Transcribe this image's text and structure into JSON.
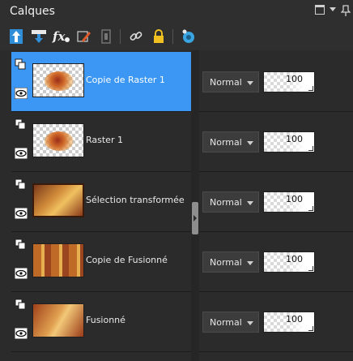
{
  "window": {
    "title": "Calques"
  },
  "toolbar": {
    "icons": [
      "move-layer-up-icon",
      "move-layer-down-icon",
      "fx-effects-icon",
      "edit-layer-icon",
      "mask-icon",
      "link-icon",
      "lock-icon",
      "palette-icon"
    ]
  },
  "layers": [
    {
      "name": "Copie de Raster 1",
      "blend_mode": "Normal",
      "opacity": "100",
      "selected": true,
      "thumb": "raster"
    },
    {
      "name": "Raster 1",
      "blend_mode": "Normal",
      "opacity": "100",
      "selected": false,
      "thumb": "raster"
    },
    {
      "name": "Sélection transformée",
      "blend_mode": "Normal",
      "opacity": "100",
      "selected": false,
      "thumb": "image"
    },
    {
      "name": "Copie de Fusionné",
      "blend_mode": "Normal",
      "opacity": "100",
      "selected": false,
      "thumb": "image"
    },
    {
      "name": "Fusionné",
      "blend_mode": "Normal",
      "opacity": "100",
      "selected": false,
      "thumb": "image"
    }
  ],
  "colors": {
    "selection": "#3b97f3",
    "background": "#2b2b2b",
    "accent_icon": "#3aa5e0"
  }
}
